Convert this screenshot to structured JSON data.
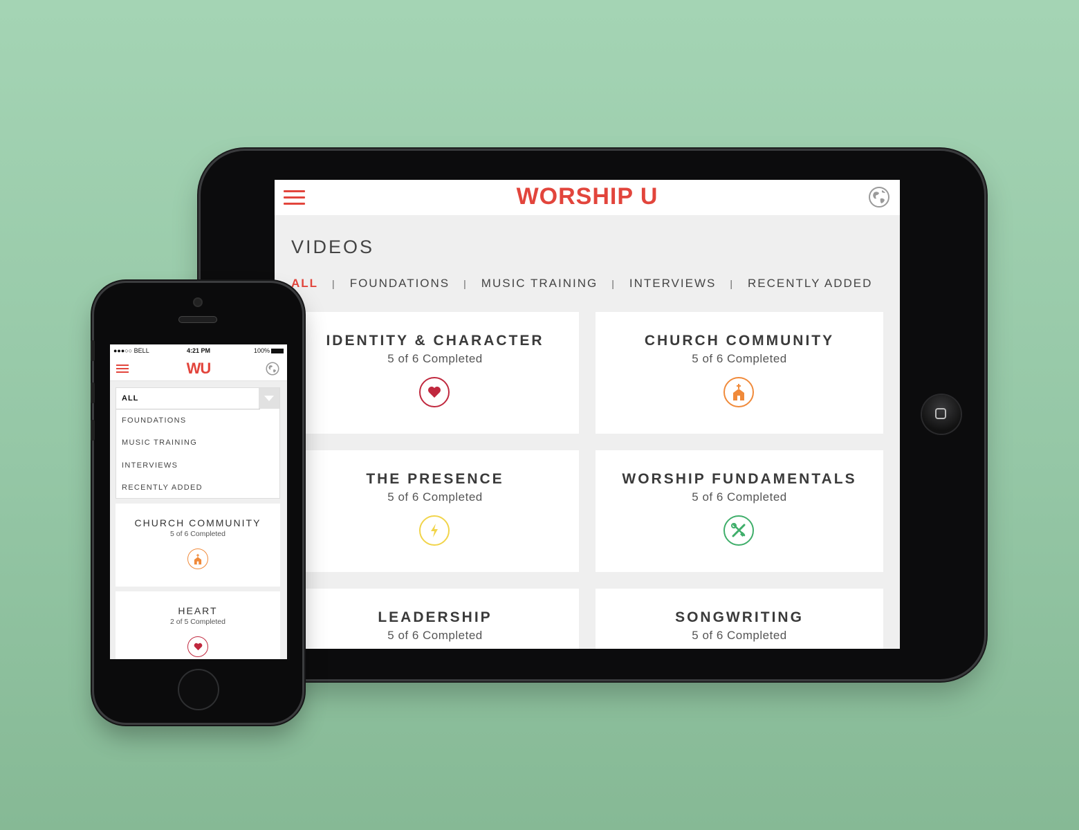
{
  "colors": {
    "brand_red": "#e2453c",
    "heart": "#c0283e",
    "church": "#f08a3a",
    "presence": "#f1d44a",
    "fundamentals": "#3fae6a"
  },
  "tablet": {
    "logo": "WORSHIP U",
    "page_title": "VIDEOS",
    "tabs": [
      {
        "label": "ALL",
        "active": true
      },
      {
        "label": "FOUNDATIONS"
      },
      {
        "label": "MUSIC TRAINING"
      },
      {
        "label": "INTERVIEWS"
      },
      {
        "label": "RECENTLY ADDED"
      }
    ],
    "tab_separator": "|",
    "cards": [
      {
        "title": "IDENTITY & CHARACTER",
        "status": "5 of 6 Completed",
        "icon": "heart-icon"
      },
      {
        "title": "CHURCH COMMUNITY",
        "status": "5 of 6 Completed",
        "icon": "church-icon"
      },
      {
        "title": "THE PRESENCE",
        "status": "5 of 6 Completed",
        "icon": "lightning-icon"
      },
      {
        "title": "WORSHIP FUNDAMENTALS",
        "status": "5 of 6 Completed",
        "icon": "tools-icon"
      },
      {
        "title": "LEADERSHIP",
        "status": "5 of 6 Completed"
      },
      {
        "title": "SONGWRITING",
        "status": "5 of 6 Completed"
      }
    ]
  },
  "phone": {
    "status_bar": {
      "carrier": "●●●○○ BELL",
      "time": "4:21 PM",
      "battery": "100%"
    },
    "logo": "WU",
    "dropdown": {
      "selected": "ALL",
      "options": [
        "FOUNDATIONS",
        "MUSIC TRAINING",
        "INTERVIEWS",
        "RECENTLY ADDED"
      ]
    },
    "cards": [
      {
        "title": "CHURCH COMMUNITY",
        "status": "5 of 6 Completed",
        "icon": "church-icon"
      },
      {
        "title": "HEART",
        "status": "2 of 5 Completed",
        "icon": "heart-icon"
      }
    ]
  }
}
